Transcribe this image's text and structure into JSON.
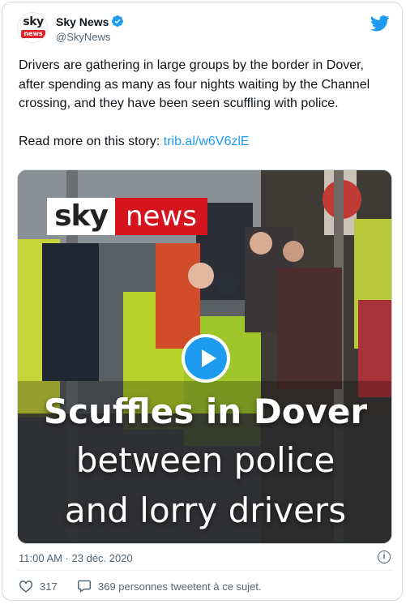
{
  "account": {
    "name": "Sky News",
    "handle": "@SkyNews",
    "avatar_top": "sky",
    "avatar_bottom": "news"
  },
  "tweet": {
    "text": "Drivers are gathering in large groups by the border in Dover, after spending as many as four nights waiting by the Channel crossing, and they have been seen scuffling with police.",
    "read_more": "Read more on this story: ",
    "link": "trib.al/w6V6zlE"
  },
  "media": {
    "brand_sky": "sky",
    "brand_news": "news",
    "caption_line1": "Scuffles in Dover",
    "caption_line2": "between police",
    "caption_line3": "and lorry drivers"
  },
  "meta": {
    "timestamp": "11:00 AM · 23 déc. 2020"
  },
  "actions": {
    "likes": "317",
    "retweets_text": "369 personnes tweetent à ce sujet."
  },
  "colors": {
    "accent": "#1d9bf0",
    "sky_red": "#d4151f"
  }
}
